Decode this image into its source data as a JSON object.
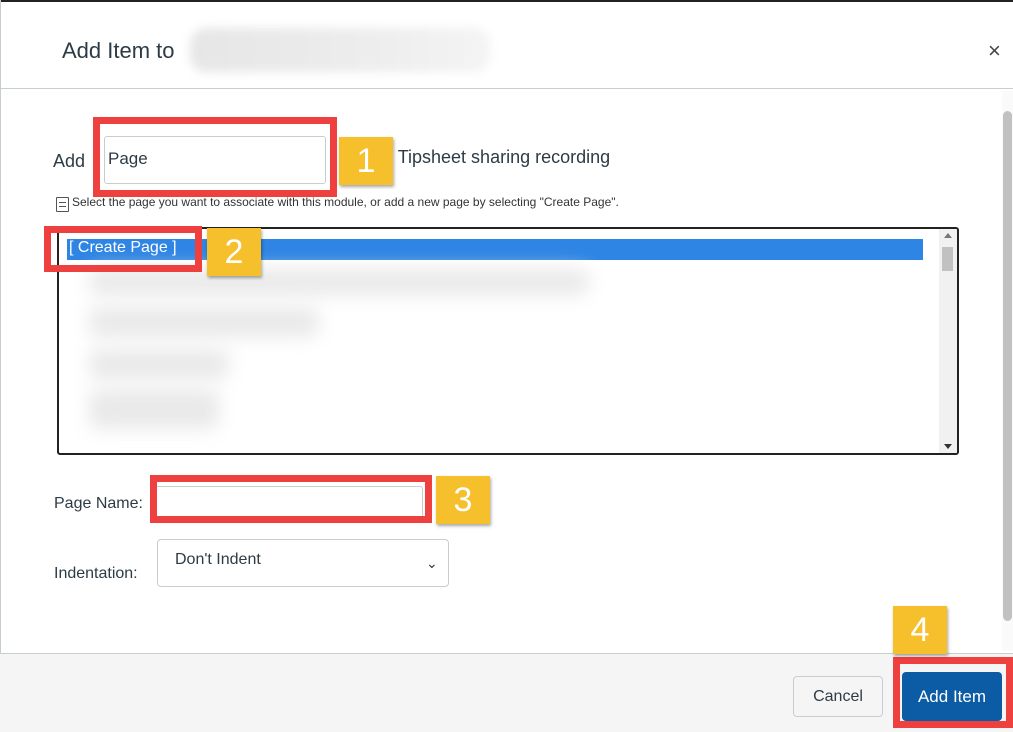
{
  "dialog": {
    "title": "Add Item to",
    "close_glyph": "×"
  },
  "body": {
    "add_label": "Add",
    "type_select_value": "Page",
    "to_text": "to Tipsheet sharing recording",
    "hint": "Select the page you want to associate with this module, or add a new page by selecting \"Create Page\".",
    "list_selected": "[ Create Page ]",
    "page_name_label": "Page Name:",
    "page_name_value": "",
    "indentation_label": "Indentation:",
    "indentation_value": "Don't Indent"
  },
  "footer": {
    "cancel_label": "Cancel",
    "add_item_label": "Add Item"
  },
  "callouts": [
    "1",
    "2",
    "3",
    "4"
  ],
  "colors": {
    "callout_border": "#ef4040",
    "callout_badge": "#f5c02c",
    "selection": "#2e85e4",
    "primary_button": "#0b5ca4"
  },
  "icons": [
    "close-icon",
    "document-icon",
    "chevron-down-icon"
  ]
}
